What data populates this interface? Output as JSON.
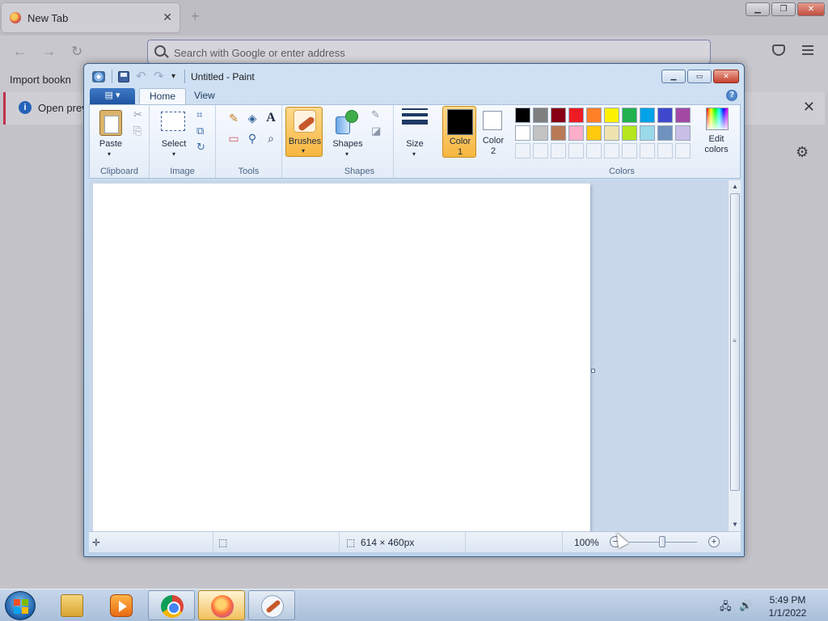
{
  "browser": {
    "tab_title": "New Tab",
    "tab_close": "✕",
    "new_tab": "+",
    "win_min": "▁",
    "win_max": "❐",
    "win_close": "✕",
    "back": "←",
    "forward": "→",
    "reload": "↻",
    "url_placeholder": "Search with Google or enter address",
    "bookmark_import": "Import bookn",
    "notice_text": "Open previ",
    "notice_close": "✕",
    "settings": "⚙"
  },
  "paint": {
    "title": "Untitled - Paint",
    "undo": "↶",
    "redo": "↷",
    "qa_dropdown": "▾",
    "ctrl_min": "▁",
    "ctrl_max": "▭",
    "ctrl_close": "✕",
    "file_menu": "▤ ▾",
    "tabs": [
      {
        "label": "Home",
        "active": true
      },
      {
        "label": "View",
        "active": false
      }
    ],
    "help": "?",
    "groups": {
      "clipboard": "Clipboard",
      "image": "Image",
      "tools": "Tools",
      "shapes": "Shapes",
      "colors": "Colors"
    },
    "buttons": {
      "paste": "Paste",
      "select": "Select",
      "brushes": "Brushes",
      "shapes": "Shapes",
      "size": "Size",
      "color1_line1": "Color",
      "color1_line2": "1",
      "color2_line1": "Color",
      "color2_line2": "2",
      "edit_line1": "Edit",
      "edit_line2": "colors"
    },
    "tool_glyphs": {
      "cut": "✂",
      "copy": "⎘",
      "crop": "⌗",
      "resize": "⧉",
      "rotate": "↻",
      "pencil": "✎",
      "fill": "◈",
      "text": "A",
      "eraser": "▭",
      "picker": "⚲",
      "magnifier": "⌕",
      "outline": "✎",
      "fill_shape": "◪",
      "caret": "▾"
    },
    "color1": "#000000",
    "color2": "#ffffff",
    "palette_row1": [
      "#000000",
      "#7f7f7f",
      "#880015",
      "#ed1c24",
      "#ff7f27",
      "#fff200",
      "#22b14c",
      "#00a2e8",
      "#3f48cc",
      "#a349a4"
    ],
    "palette_row2": [
      "#ffffff",
      "#c3c3c3",
      "#b97a57",
      "#ffaec9",
      "#ffc90e",
      "#efe4b0",
      "#b5e61d",
      "#99d9ea",
      "#7092be",
      "#c8bfe7"
    ],
    "status": {
      "move_icon": "✛",
      "select_icon": "⬚",
      "size_icon": "⬚",
      "size": "614 × 460px",
      "zoom": "100%",
      "zoom_out": "−",
      "zoom_in": "+"
    },
    "scroll_up": "▲",
    "scroll_down": "▼",
    "scroll_grip": "≡"
  },
  "taskbar": {
    "time": "5:49 PM",
    "date": "1/1/2022",
    "tray_network": "🖧",
    "tray_volume": "🔊"
  }
}
